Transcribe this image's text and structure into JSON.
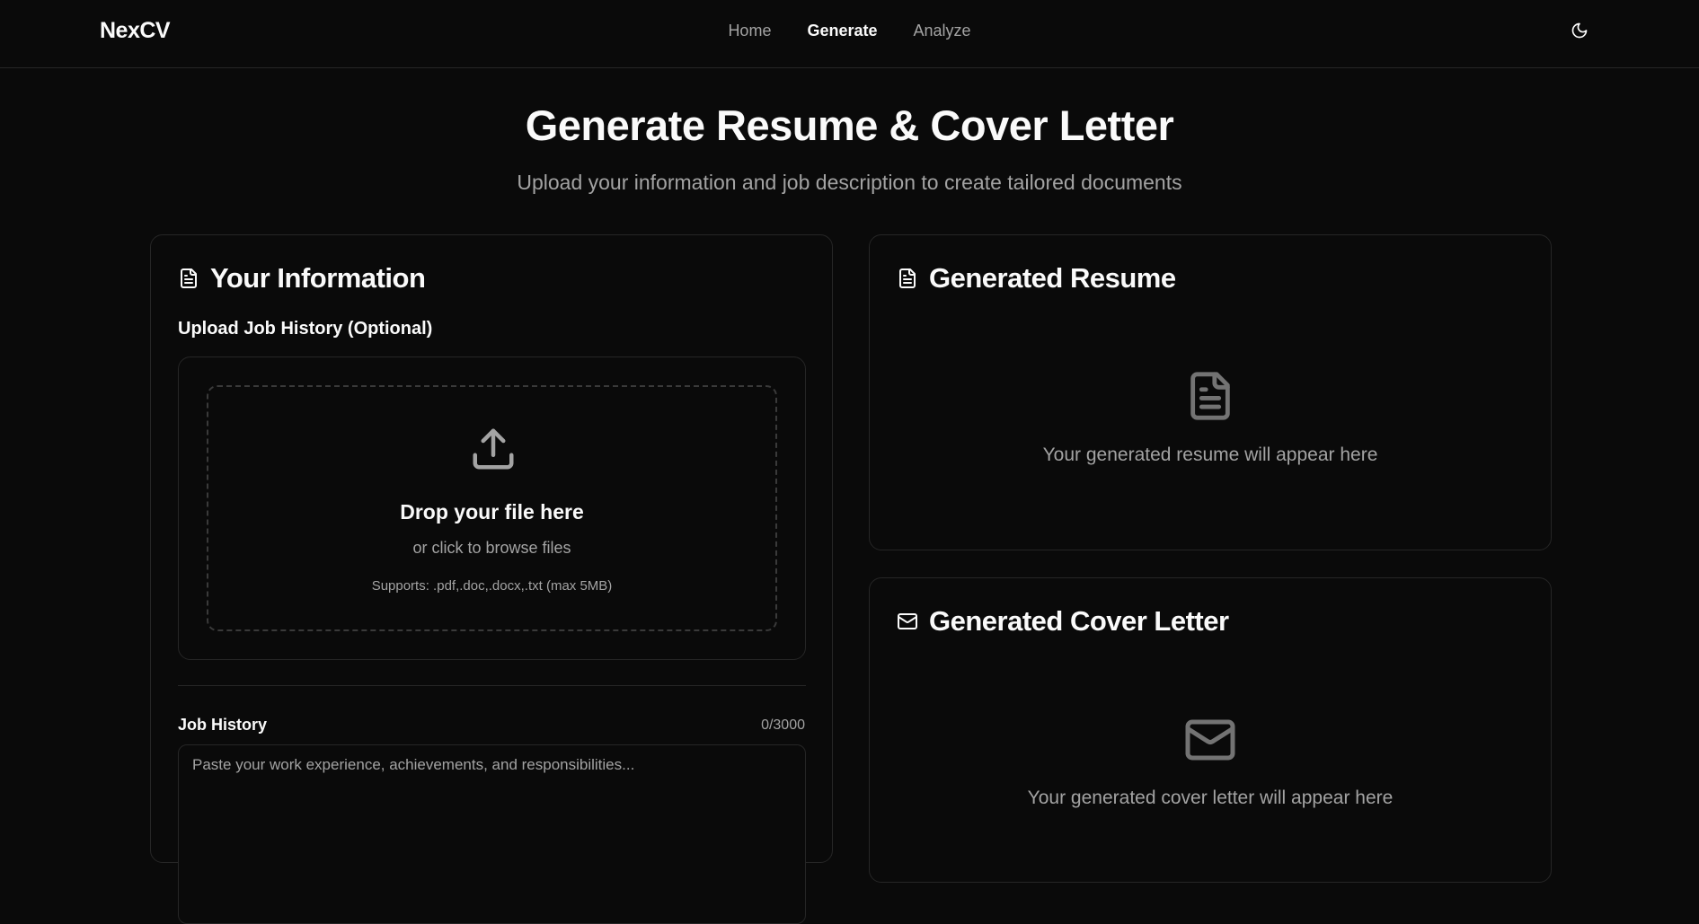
{
  "nav": {
    "brand": "NexCV",
    "links": [
      {
        "label": "Home",
        "active": false
      },
      {
        "label": "Generate",
        "active": true
      },
      {
        "label": "Analyze",
        "active": false
      }
    ],
    "theme_toggle_icon": "moon-icon"
  },
  "hero": {
    "title": "Generate Resume & Cover Letter",
    "subtitle": "Upload your information and job description to create tailored documents"
  },
  "info_card": {
    "icon": "file-text-icon",
    "title": "Your Information",
    "upload_label": "Upload Job History (Optional)",
    "dropzone": {
      "icon": "upload-icon",
      "title": "Drop your file here",
      "subtitle": "or click to browse files",
      "supports": "Supports: .pdf,.doc,.docx,.txt (max 5MB)"
    },
    "job_history": {
      "label": "Job History",
      "count": "0/3000",
      "placeholder": "Paste your work experience, achievements, and responsibilities..."
    }
  },
  "resume_card": {
    "icon": "file-text-icon",
    "title": "Generated Resume",
    "placeholder": "Your generated resume will appear here"
  },
  "cover_card": {
    "icon": "mail-icon",
    "title": "Generated Cover Letter",
    "placeholder": "Your generated cover letter will appear here"
  },
  "colors": {
    "background": "#0a0a0a",
    "border": "#262626",
    "text": "#fafafa",
    "muted": "#a3a3a3",
    "icon_muted": "#737373"
  }
}
